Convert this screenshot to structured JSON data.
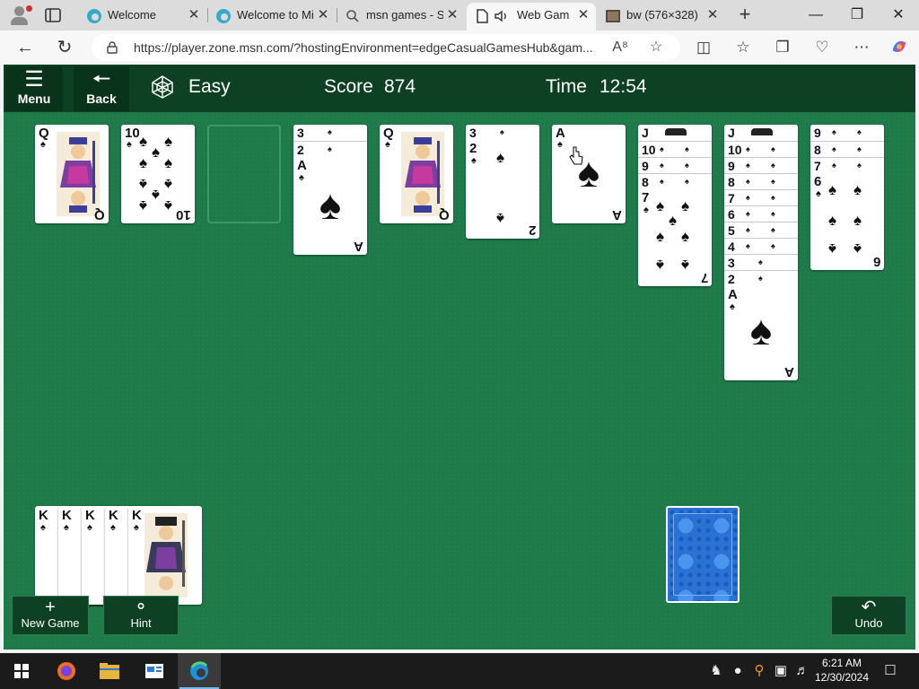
{
  "browser": {
    "tabs": [
      {
        "label": "Welcome",
        "icon": "edge-icon"
      },
      {
        "label": "Welcome to Mi",
        "icon": "edge-icon"
      },
      {
        "label": "msn games - Se",
        "icon": "search-icon"
      },
      {
        "label": "Web Game",
        "icon": "page-icon"
      },
      {
        "label": "bw (576×328)",
        "icon": "image-icon"
      }
    ],
    "close_glyph": "✕",
    "new_tab_glyph": "+",
    "url": "https://player.zone.msn.com/?hostingEnvironment=edgeCasualGamesHub&gam...",
    "window_controls": {
      "minimize": "—",
      "restore": "❐",
      "close": "✕"
    }
  },
  "game": {
    "header": {
      "menu_label": "Menu",
      "back_label": "Back",
      "difficulty": "Easy",
      "score_label": "Score",
      "score_value": "874",
      "time_label": "Time",
      "time_value": "12:54"
    },
    "suit": "♠",
    "columns": [
      {
        "cards": [
          "Q"
        ]
      },
      {
        "cards": [
          "10"
        ]
      },
      {
        "cards": []
      },
      {
        "cards": [
          "3",
          "2",
          "A"
        ]
      },
      {
        "cards": [
          "Q"
        ]
      },
      {
        "cards": [
          "3",
          "2"
        ]
      },
      {
        "cards": [
          "A"
        ]
      },
      {
        "cards": [
          "J",
          "10",
          "9",
          "8",
          "7"
        ]
      },
      {
        "cards": [
          "J",
          "10",
          "9",
          "8",
          "7",
          "6",
          "5",
          "4",
          "3",
          "2",
          "A"
        ]
      },
      {
        "cards": [
          "9",
          "8",
          "7",
          "6"
        ]
      }
    ],
    "completed_stacks": [
      "K",
      "K",
      "K",
      "K",
      "K"
    ],
    "buttons": {
      "new_game": "New Game",
      "hint": "Hint",
      "undo": "Undo"
    },
    "colors": {
      "felt": "#1e7a49",
      "bar": "#0e4024",
      "deck": "#2b72d6"
    }
  },
  "taskbar": {
    "time": "6:21 AM",
    "date": "12/30/2024",
    "apps": [
      "firefox-icon",
      "file-explorer-icon",
      "news-icon",
      "edge-icon"
    ]
  }
}
